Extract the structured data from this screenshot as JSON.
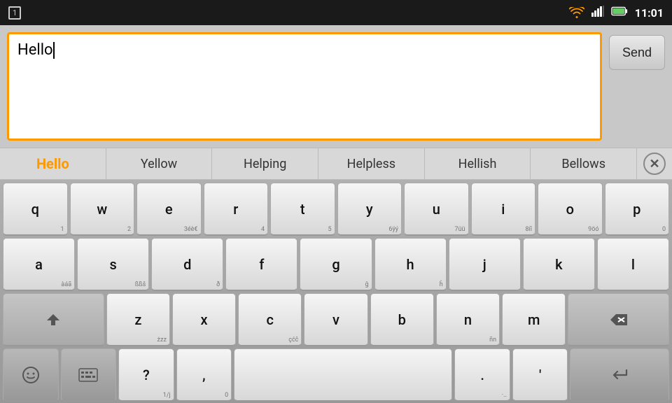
{
  "status_bar": {
    "icon_label": "1",
    "time": "11:01"
  },
  "input_area": {
    "text_value": "Hello",
    "send_label": "Send"
  },
  "suggestions": [
    {
      "id": "hello",
      "label": "Hello",
      "selected": true
    },
    {
      "id": "yellow",
      "label": "Yellow",
      "selected": false
    },
    {
      "id": "helping",
      "label": "Helping",
      "selected": false
    },
    {
      "id": "helpless",
      "label": "Helpless",
      "selected": false
    },
    {
      "id": "hellish",
      "label": "Hellish",
      "selected": false
    },
    {
      "id": "bellows",
      "label": "Bellows",
      "selected": false
    }
  ],
  "keyboard": {
    "rows": [
      [
        {
          "main": "q",
          "sub": "1"
        },
        {
          "main": "w",
          "sub": "2"
        },
        {
          "main": "e",
          "sub": "3éè€"
        },
        {
          "main": "r",
          "sub": "4"
        },
        {
          "main": "t",
          "sub": "5"
        },
        {
          "main": "y",
          "sub": "6ÿý"
        },
        {
          "main": "u",
          "sub": "7üü"
        },
        {
          "main": "i",
          "sub": "8íî"
        },
        {
          "main": "o",
          "sub": "9öó"
        },
        {
          "main": "p",
          "sub": "0"
        }
      ],
      [
        {
          "main": "a",
          "sub": "àáã"
        },
        {
          "main": "s",
          "sub": "ßßš"
        },
        {
          "main": "d",
          "sub": "ð"
        },
        {
          "main": "f",
          "sub": ""
        },
        {
          "main": "g",
          "sub": "ĝ"
        },
        {
          "main": "h",
          "sub": "ĥ"
        },
        {
          "main": "j",
          "sub": ""
        },
        {
          "main": "k",
          "sub": ""
        },
        {
          "main": "l",
          "sub": ""
        }
      ],
      "shift_row",
      "bottom_row"
    ],
    "shift_symbol": "⇧",
    "backspace_symbol": "⌫",
    "enter_symbol": "↵"
  }
}
